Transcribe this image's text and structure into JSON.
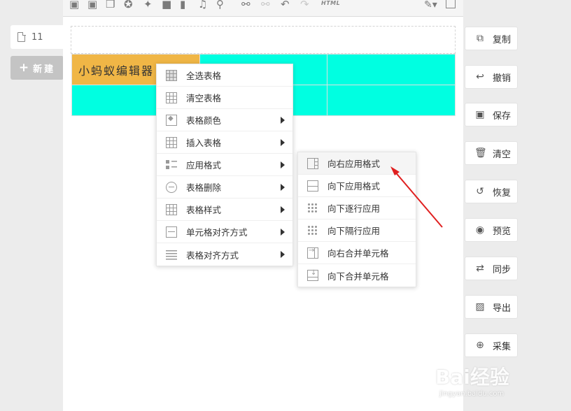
{
  "sidebar": {
    "doc_tab_label": "11",
    "new_label": "新建"
  },
  "toolbar": {
    "html_label": "HTML"
  },
  "table": {
    "cell_text": "小蚂蚁编辑器"
  },
  "context_menu": {
    "items": [
      {
        "label": "全选表格",
        "icon": "table-grid-icon",
        "submenu": false
      },
      {
        "label": "清空表格",
        "icon": "table-clear-icon",
        "submenu": false
      },
      {
        "label": "表格颜色",
        "icon": "paint-bucket-icon",
        "submenu": true
      },
      {
        "label": "插入表格",
        "icon": "table-insert-icon",
        "submenu": true
      },
      {
        "label": "应用格式",
        "icon": "apply-format-icon",
        "submenu": true
      },
      {
        "label": "表格删除",
        "icon": "minus-circle-icon",
        "submenu": true
      },
      {
        "label": "表格样式",
        "icon": "table-style-icon",
        "submenu": true
      },
      {
        "label": "单元格对齐方式",
        "icon": "cell-align-icon",
        "submenu": true
      },
      {
        "label": "表格对齐方式",
        "icon": "table-align-icon",
        "submenu": true
      }
    ]
  },
  "submenu": {
    "items": [
      {
        "label": "向右应用格式",
        "icon": "apply-right-icon"
      },
      {
        "label": "向下应用格式",
        "icon": "apply-down-icon"
      },
      {
        "label": "向下逐行应用",
        "icon": "apply-each-row-icon"
      },
      {
        "label": "向下隔行应用",
        "icon": "apply-alternate-row-icon"
      },
      {
        "label": "向右合并单元格",
        "icon": "merge-right-icon"
      },
      {
        "label": "向下合并单元格",
        "icon": "merge-down-icon"
      }
    ]
  },
  "actions": {
    "copy": "复制",
    "undo": "撤销",
    "save": "保存",
    "clear": "清空",
    "restore": "恢复",
    "preview": "预览",
    "sync": "同步",
    "export": "导出",
    "collect": "采集"
  },
  "watermark": {
    "brand": "Bai经验",
    "url": "jingyan.baidu.com"
  },
  "colors": {
    "selected_cell": "#f0b646",
    "table_cell": "#00ffe1",
    "annotation_arrow": "#e02020"
  }
}
